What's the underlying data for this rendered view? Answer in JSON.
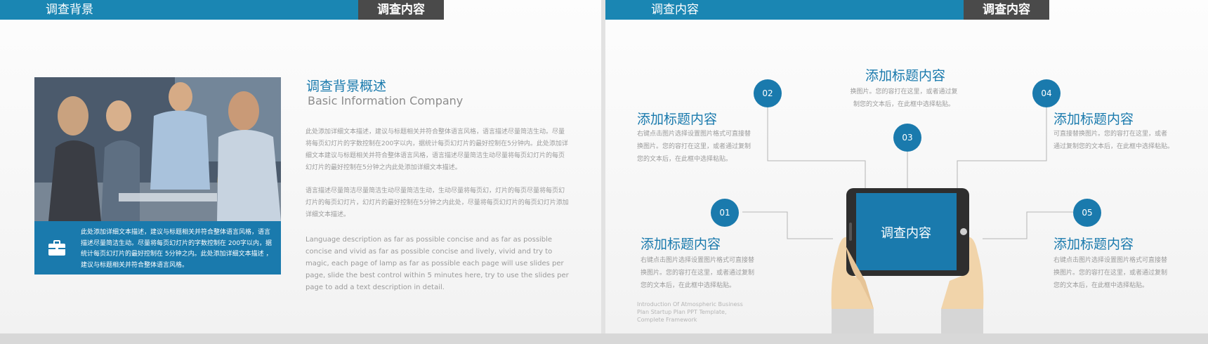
{
  "left": {
    "header": {
      "title": "调查背景",
      "tab": "调查内容"
    },
    "heading": "调查背景概述",
    "subheading": "Basic Information Company",
    "paragraph1": "此处添加详细文本描述，建议与标题相关并符合整体语言风格，语言描述尽量简洁生动。尽量将每页幻灯片的字数控制在200字以内，据统计每页幻灯片的最好控制在5分钟内。此处添加详细文本建议与标题相关并符合整体语言风格，语言描述尽量简洁生动尽量将每页幻灯片的每页幻灯片的最好控制在5分钟之内此处添加详细文本描述。",
    "paragraph2": "语言描述尽量简洁尽量简洁生动尽量简洁生动，生动尽量将每页幻，灯片的每页尽量将每页幻灯片的每页幻灯片，幻灯片的最好控制在5分钟之内此处，尽量将每页幻灯片的每页幻灯片添加详细文本描述。",
    "paragraph3": "Language description as far as possible concise and as far as possible concise and vivid as far as possible concise and lively, vivid and try to magic, each page of lamp as far as possible each page will use slides per page, slide the best control within 5 minutes here, try to use the slides per page to add a text description in detail.",
    "info_text": "此处添加详细文本描述，建议与标题相关并符合整体语言风格，语言描述尽量简洁生动。尽量将每页幻灯片的字数控制在 200字以内，据统计每页幻灯片的最好控制在 5分钟之内。此处添加详细文本描述 ，建议与标题相关并符合整体语言风格。",
    "info_icon": "briefcase-icon"
  },
  "right": {
    "header": {
      "title": "调查内容",
      "tab": "调查内容"
    },
    "device_label": "调查内容",
    "items": [
      {
        "num": "01",
        "title": "添加标题内容",
        "text": [
          "右键点击图片选择设置图片格式可直接替",
          "换图片。您的容打在这里，或者通过复制",
          "您的文本后，在此框中选择粘贴。"
        ]
      },
      {
        "num": "02",
        "title": "添加标题内容",
        "text": [
          "右键点击图片选择设置图片格式可直接替",
          "换图片。您的容打在这里，或者通过复制",
          "您的文本后，在此框中选择粘贴。"
        ]
      },
      {
        "num": "03",
        "title": "添加标题内容",
        "text": [
          "换图片。您的容打在这里，或者通过复",
          "制您的文本后，在此框中选择粘贴。"
        ]
      },
      {
        "num": "04",
        "title": "添加标题内容",
        "text": [
          "可直接替换图片。您的容打在这里，或者",
          "通过复制您的文本后，在此框中选择粘贴。"
        ]
      },
      {
        "num": "05",
        "title": "添加标题内容",
        "text": [
          "右键点击图片选择设置图片格式可直接替",
          "换图片。您的容打在这里，或者通过复制",
          "您的文本后，在此框中选择粘贴。"
        ]
      }
    ],
    "intro_lines": [
      "Introduction Of Atmospheric  Business",
      "Plan Startup  Plan PPT Template,",
      "Complete Framework"
    ]
  },
  "colors": {
    "accent": "#1a7aad",
    "header_blue": "#1a86b3",
    "tab_dark": "#4a4a4a"
  }
}
